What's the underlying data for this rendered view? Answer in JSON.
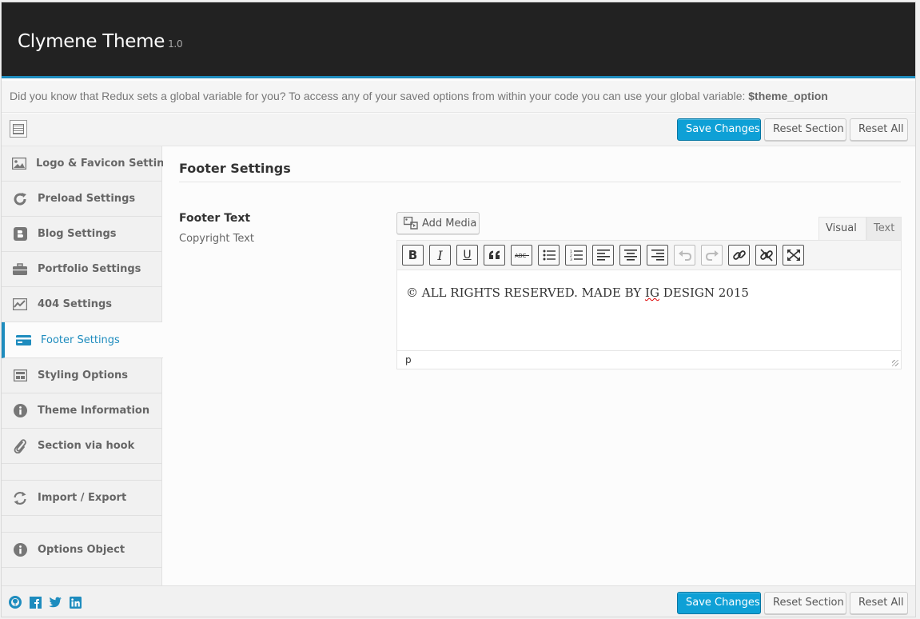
{
  "header": {
    "title": "Clymene Theme",
    "version": "1.0"
  },
  "notice": {
    "text": "Did you know that Redux sets a global variable for you? To access any of your saved options from within your code you can use your global variable: ",
    "variable": "$theme_option"
  },
  "toolbar": {
    "save_label": "Save Changes",
    "reset_section_label": "Reset Section",
    "reset_all_label": "Reset All"
  },
  "sidebar": {
    "items": [
      {
        "label": "Logo & Favicon Settings",
        "icon": "image-icon"
      },
      {
        "label": "Preload Settings",
        "icon": "refresh-icon"
      },
      {
        "label": "Blog Settings",
        "icon": "blogger-icon"
      },
      {
        "label": "Portfolio Settings",
        "icon": "briefcase-icon"
      },
      {
        "label": "404 Settings",
        "icon": "chart-icon"
      },
      {
        "label": "Footer Settings",
        "icon": "credit-card-icon",
        "active": true
      },
      {
        "label": "Styling Options",
        "icon": "layout-icon"
      },
      {
        "label": "Theme Information",
        "icon": "info-icon"
      },
      {
        "label": "Section via hook",
        "icon": "paperclip-icon"
      },
      {
        "label": "Import / Export",
        "icon": "refresh-icon"
      },
      {
        "label": "Options Object",
        "icon": "info-icon"
      }
    ]
  },
  "main": {
    "section_title": "Footer Settings",
    "field": {
      "title": "Footer Text",
      "subtitle": "Copyright Text",
      "add_media_label": "Add Media",
      "tab_visual": "Visual",
      "tab_text": "Text",
      "content_before": "© ALL RIGHTS RESERVED. MADE BY ",
      "content_misspelled": "IG",
      "content_after": " DESIGN 2015",
      "status_path": "p"
    },
    "editor_buttons": [
      "bold-icon",
      "italic-icon",
      "underline-icon",
      "blockquote-icon",
      "strikethrough-icon",
      "bullet-list-icon",
      "numbered-list-icon",
      "align-left-icon",
      "align-center-icon",
      "align-right-icon",
      "undo-icon",
      "redo-icon",
      "link-icon",
      "unlink-icon",
      "fullscreen-icon"
    ]
  },
  "footer": {
    "social_icons": [
      "github-icon",
      "facebook-icon",
      "twitter-icon",
      "linkedin-icon"
    ]
  },
  "colors": {
    "accent": "#1e8cbe",
    "primary_button": "#0ea0d6",
    "header_bg": "#222222"
  }
}
